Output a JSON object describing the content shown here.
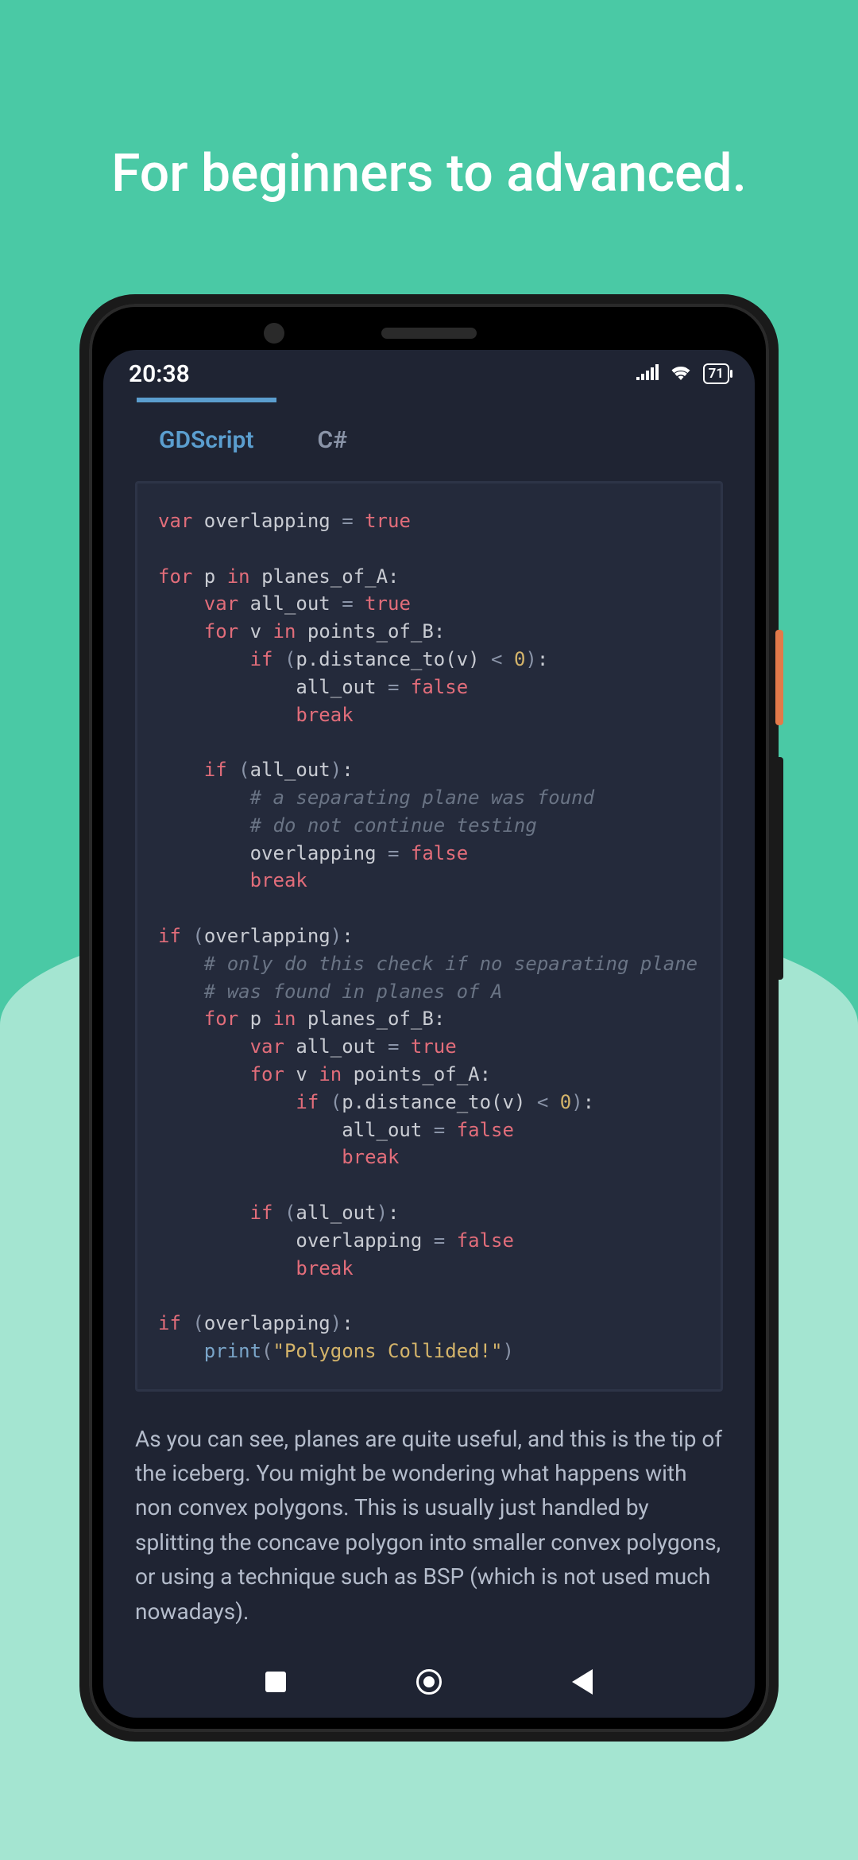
{
  "headline": "For beginners to advanced.",
  "status": {
    "time": "20:38",
    "battery": "71"
  },
  "tabs": {
    "active": "GDScript",
    "inactive": "C#"
  },
  "code": {
    "tokens": [
      [
        [
          "kw",
          "var"
        ],
        [
          "id",
          " overlapping "
        ],
        [
          "op",
          "="
        ],
        [
          "id",
          " "
        ],
        [
          "lit",
          "true"
        ]
      ],
      [],
      [
        [
          "kw",
          "for"
        ],
        [
          "id",
          " p "
        ],
        [
          "kw",
          "in"
        ],
        [
          "id",
          " planes_of_A:"
        ]
      ],
      [
        [
          "id",
          "    "
        ],
        [
          "kw",
          "var"
        ],
        [
          "id",
          " all_out "
        ],
        [
          "op",
          "="
        ],
        [
          "id",
          " "
        ],
        [
          "lit",
          "true"
        ]
      ],
      [
        [
          "id",
          "    "
        ],
        [
          "kw",
          "for"
        ],
        [
          "id",
          " v "
        ],
        [
          "kw",
          "in"
        ],
        [
          "id",
          " points_of_B:"
        ]
      ],
      [
        [
          "id",
          "        "
        ],
        [
          "kw",
          "if"
        ],
        [
          "id",
          " "
        ],
        [
          "op",
          "("
        ],
        [
          "id",
          "p.distance_to(v) "
        ],
        [
          "op",
          "<"
        ],
        [
          "id",
          " "
        ],
        [
          "num",
          "0"
        ],
        [
          "op",
          ")"
        ],
        [
          "id",
          ":"
        ]
      ],
      [
        [
          "id",
          "            all_out "
        ],
        [
          "op",
          "="
        ],
        [
          "id",
          " "
        ],
        [
          "lit",
          "false"
        ]
      ],
      [
        [
          "id",
          "            "
        ],
        [
          "kw",
          "break"
        ]
      ],
      [],
      [
        [
          "id",
          "    "
        ],
        [
          "kw",
          "if"
        ],
        [
          "id",
          " "
        ],
        [
          "op",
          "("
        ],
        [
          "id",
          "all_out"
        ],
        [
          "op",
          ")"
        ],
        [
          "id",
          ":"
        ]
      ],
      [
        [
          "id",
          "        "
        ],
        [
          "cm",
          "# a separating plane was found"
        ]
      ],
      [
        [
          "id",
          "        "
        ],
        [
          "cm",
          "# do not continue testing"
        ]
      ],
      [
        [
          "id",
          "        overlapping "
        ],
        [
          "op",
          "="
        ],
        [
          "id",
          " "
        ],
        [
          "lit",
          "false"
        ]
      ],
      [
        [
          "id",
          "        "
        ],
        [
          "kw",
          "break"
        ]
      ],
      [],
      [
        [
          "kw",
          "if"
        ],
        [
          "id",
          " "
        ],
        [
          "op",
          "("
        ],
        [
          "id",
          "overlapping"
        ],
        [
          "op",
          ")"
        ],
        [
          "id",
          ":"
        ]
      ],
      [
        [
          "id",
          "    "
        ],
        [
          "cm",
          "# only do this check if no separating plane"
        ]
      ],
      [
        [
          "id",
          "    "
        ],
        [
          "cm",
          "# was found in planes of A"
        ]
      ],
      [
        [
          "id",
          "    "
        ],
        [
          "kw",
          "for"
        ],
        [
          "id",
          " p "
        ],
        [
          "kw",
          "in"
        ],
        [
          "id",
          " planes_of_B:"
        ]
      ],
      [
        [
          "id",
          "        "
        ],
        [
          "kw",
          "var"
        ],
        [
          "id",
          " all_out "
        ],
        [
          "op",
          "="
        ],
        [
          "id",
          " "
        ],
        [
          "lit",
          "true"
        ]
      ],
      [
        [
          "id",
          "        "
        ],
        [
          "kw",
          "for"
        ],
        [
          "id",
          " v "
        ],
        [
          "kw",
          "in"
        ],
        [
          "id",
          " points_of_A:"
        ]
      ],
      [
        [
          "id",
          "            "
        ],
        [
          "kw",
          "if"
        ],
        [
          "id",
          " "
        ],
        [
          "op",
          "("
        ],
        [
          "id",
          "p.distance_to(v) "
        ],
        [
          "op",
          "<"
        ],
        [
          "id",
          " "
        ],
        [
          "num",
          "0"
        ],
        [
          "op",
          ")"
        ],
        [
          "id",
          ":"
        ]
      ],
      [
        [
          "id",
          "                all_out "
        ],
        [
          "op",
          "="
        ],
        [
          "id",
          " "
        ],
        [
          "lit",
          "false"
        ]
      ],
      [
        [
          "id",
          "                "
        ],
        [
          "kw",
          "break"
        ]
      ],
      [],
      [
        [
          "id",
          "        "
        ],
        [
          "kw",
          "if"
        ],
        [
          "id",
          " "
        ],
        [
          "op",
          "("
        ],
        [
          "id",
          "all_out"
        ],
        [
          "op",
          ")"
        ],
        [
          "id",
          ":"
        ]
      ],
      [
        [
          "id",
          "            overlapping "
        ],
        [
          "op",
          "="
        ],
        [
          "id",
          " "
        ],
        [
          "lit",
          "false"
        ]
      ],
      [
        [
          "id",
          "            "
        ],
        [
          "kw",
          "break"
        ]
      ],
      [],
      [
        [
          "kw",
          "if"
        ],
        [
          "id",
          " "
        ],
        [
          "op",
          "("
        ],
        [
          "id",
          "overlapping"
        ],
        [
          "op",
          ")"
        ],
        [
          "id",
          ":"
        ]
      ],
      [
        [
          "id",
          "    "
        ],
        [
          "fn",
          "print"
        ],
        [
          "op",
          "("
        ],
        [
          "str",
          "\"Polygons Collided!\""
        ],
        [
          "op",
          ")"
        ]
      ]
    ]
  },
  "paragraph": "As you can see, planes are quite useful, and this is the tip of the iceberg. You might be wondering what happens with non convex polygons. This is usually just handled by splitting the concave polygon into smaller convex polygons, or using a technique such as BSP (which is not used much nowadays)."
}
